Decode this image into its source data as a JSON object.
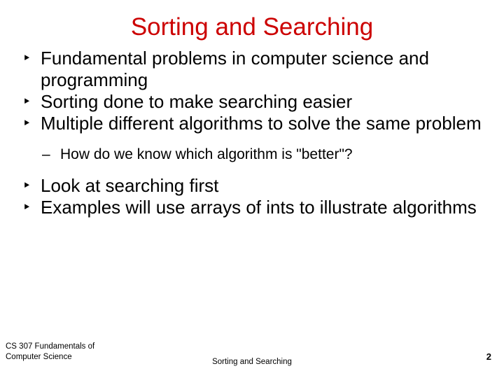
{
  "slide": {
    "title": "Sorting and Searching",
    "title_color": "#cc0000",
    "bullet_marker": "‣",
    "sub_bullet_marker": "–",
    "bullets": [
      "Fundamental problems in computer science and programming",
      "Sorting done to make searching easier",
      "Multiple different algorithms to solve the same problem"
    ],
    "sub_bullets": [
      "How do we know which algorithm is \"better\"?"
    ],
    "bullets_after": [
      "Look at searching first",
      "Examples will use arrays of ints to illustrate algorithms"
    ]
  },
  "footer": {
    "left_line1": "CS 307 Fundamentals of",
    "left_line2": "Computer Science",
    "center": "Sorting and Searching",
    "page_number": "2"
  }
}
